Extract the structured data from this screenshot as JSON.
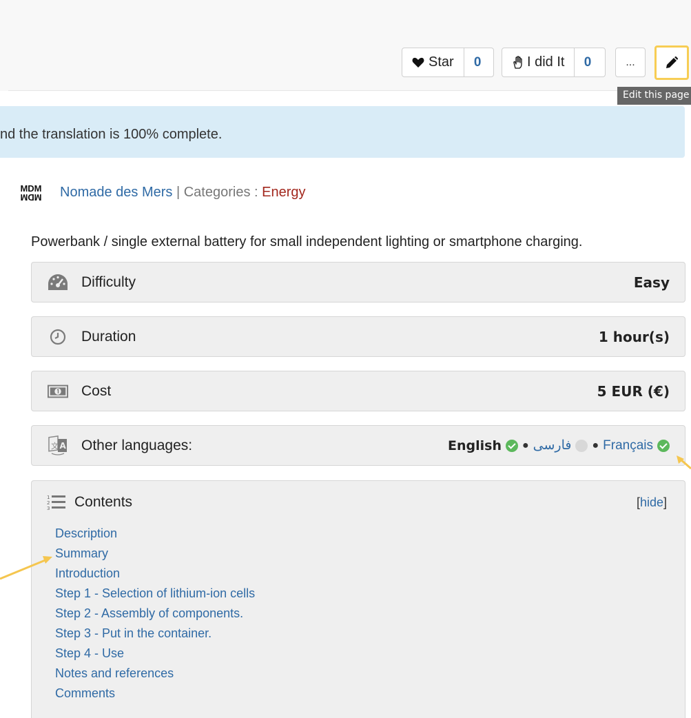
{
  "toolbar": {
    "star_label": "Star",
    "star_count": "0",
    "did_it_label": "I did It",
    "did_it_count": "0",
    "more_label": "...",
    "edit_tooltip": "Edit this page"
  },
  "notice": {
    "text": "nd the translation is 100% complete."
  },
  "author": {
    "name": "Nomade des Mers",
    "separator": "|",
    "categories_label": "Categories :",
    "category": "Energy",
    "logo_text": "MDM"
  },
  "description": "Powerbank / single external battery for small independent lighting or smartphone charging.",
  "info": {
    "difficulty_label": "Difficulty",
    "difficulty_value": "Easy",
    "duration_label": "Duration",
    "duration_value": "1 hour(s)",
    "cost_label": "Cost",
    "cost_value": "5 EUR (€)",
    "languages_label": "Other languages:"
  },
  "languages": [
    {
      "name": "English",
      "status": "complete"
    },
    {
      "name": "فارسی",
      "status": "incomplete"
    },
    {
      "name": "Français",
      "status": "complete"
    }
  ],
  "toc": {
    "title": "Contents",
    "hide_open": "[",
    "hide_label": "hide",
    "hide_close": "]",
    "items": [
      "Description",
      "Summary",
      "Introduction",
      "Step 1 - Selection of lithium-ion cells",
      "Step 2 - Assembly of components.",
      "Step 3 - Put in the container.",
      "Step 4 - Use",
      "Notes and references",
      "Comments"
    ]
  },
  "colors": {
    "link": "#2f6aa5",
    "category": "#a2271d",
    "notice_bg": "#d9ecf7",
    "highlight": "#f7cd54",
    "check": "#5cb85c"
  }
}
